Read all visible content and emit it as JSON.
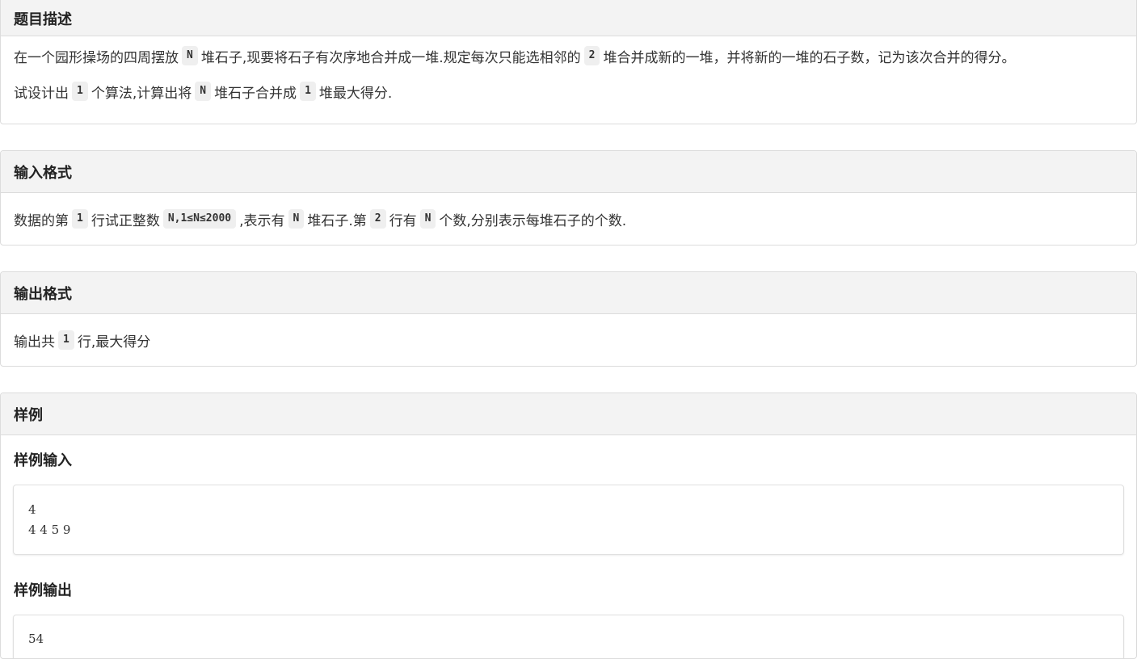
{
  "description": {
    "title": "题目描述",
    "p1": {
      "t1": "在一个园形操场的四周摆放",
      "c1": "N",
      "t2": "堆石子,现要将石子有次序地合并成一堆.规定每次只能选相邻的",
      "c2": "2",
      "t3": "堆合并成新的一堆，并将新的一堆的石子数，记为该次合并的得分。"
    },
    "p2": {
      "t1": "试设计出",
      "c1": "1",
      "t2": "个算法,计算出将",
      "c2": "N",
      "t3": "堆石子合并成",
      "c3": "1",
      "t4": "堆最大得分."
    }
  },
  "input_format": {
    "title": "输入格式",
    "p1": {
      "t1": "数据的第",
      "c1": "1",
      "t2": "行试正整数",
      "c2": "N,1≤N≤2000",
      "t3": ",表示有",
      "c3": "N",
      "t4": "堆石子.第",
      "c4": "2",
      "t5": "行有",
      "c5": "N",
      "t6": "个数,分别表示每堆石子的个数."
    }
  },
  "output_format": {
    "title": "输出格式",
    "p1": {
      "t1": "输出共",
      "c1": "1",
      "t2": "行,最大得分"
    }
  },
  "sample": {
    "title": "样例",
    "input_title": "样例输入",
    "input_text": "4\n4 4 5 9",
    "output_title": "样例输出",
    "output_text": "54"
  }
}
